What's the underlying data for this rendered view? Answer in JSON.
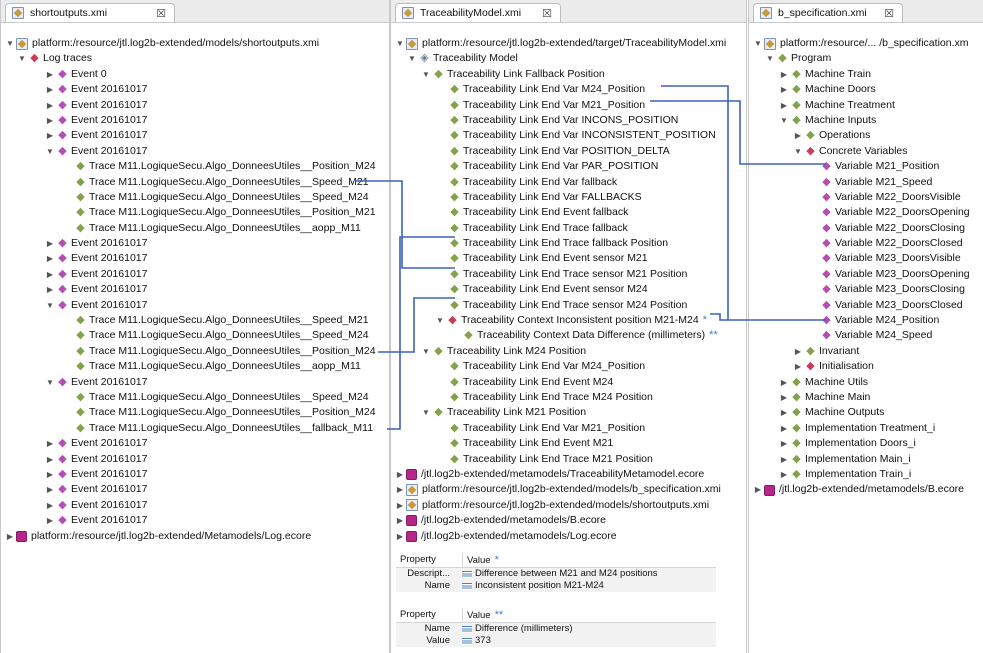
{
  "accent_color": "#3a63b8",
  "left": {
    "tab": "shortoutputs.xmi",
    "root": "platform:/resource/jtl.log2b-extended/models/shortoutputs.xmi",
    "log_traces": "Log traces",
    "event0": "Event 0",
    "event": "Event 20161017",
    "trace_speed_m21": "Trace M11.LogiqueSecu.Algo_DonneesUtiles__Speed_M21",
    "trace_speed_m24": "Trace M11.LogiqueSecu.Algo_DonneesUtiles__Speed_M24",
    "trace_pos_m21": "Trace M11.LogiqueSecu.Algo_DonneesUtiles__Position_M21",
    "trace_pos_m24": "Trace M11.LogiqueSecu.Algo_DonneesUtiles__Position_M24",
    "trace_aopp": "Trace M11.LogiqueSecu.Algo_DonneesUtiles__aopp_M11",
    "trace_fallback": "Trace M11.LogiqueSecu.Algo_DonneesUtiles__fallback_M11",
    "log_ecore": "platform:/resource/jtl.log2b-extended/Metamodels/Log.ecore"
  },
  "middle": {
    "tab": "TraceabilityModel.xmi",
    "root": "platform:/resource/jtl.log2b-extended/target/TraceabilityModel.xmi",
    "model": "Traceability Model",
    "fallback_position": "Traceability Link Fallback Position",
    "end_var_m24_pos": "Traceability Link End Var M24_Position",
    "end_var_m21_pos": "Traceability Link End Var M21_Position",
    "end_var_incons": "Traceability Link End Var INCONS_POSITION",
    "end_var_inconsistent": "Traceability Link End Var INCONSISTENT_POSITION",
    "end_var_delta": "Traceability Link End Var POSITION_DELTA",
    "end_var_par": "Traceability Link End Var PAR_POSITION",
    "end_var_fallback": "Traceability Link End Var fallback",
    "end_var_fallbacks": "Traceability Link End Var FALLBACKS",
    "end_event_fallback": "Traceability Link End Event fallback",
    "end_trace_fallback": "Traceability Link End Trace fallback",
    "end_trace_fallback_pos": "Traceability Link End Trace fallback Position",
    "end_event_sensor_m21": "Traceability Link End Event sensor M21",
    "end_trace_sensor_m21_pos": "Traceability Link End Trace sensor M21 Position",
    "end_event_sensor_m24": "Traceability Link End Event sensor M24",
    "end_trace_sensor_m24_pos": "Traceability Link End Trace sensor M24 Position",
    "context_incons": "Traceability Context Inconsistent position M21-M24",
    "context_data_diff": "Traceability Context Data Difference (millimeters)",
    "stars1": "*",
    "stars2": "**",
    "m24_position": "Traceability Link M24 Position",
    "end_var_m24_pos2": "Traceability Link End Var M24_Position",
    "end_event_m24": "Traceability Link End Event M24",
    "end_trace_m24_pos": "Traceability Link End Trace M24 Position",
    "m21_position": "Traceability Link M21 Position",
    "end_var_m21_pos2": "Traceability Link End Var M21_Position",
    "end_event_m21": "Traceability Link End Event M21",
    "end_trace_m21_pos": "Traceability Link End Trace M21 Position",
    "res_trace_metamodel": "/jtl.log2b-extended/metamodels/TraceabilityMetamodel.ecore",
    "res_b_spec": "platform:/resource/jtl.log2b-extended/models/b_specification.xmi",
    "res_shortoutputs": "platform:/resource/jtl.log2b-extended/models/shortoutputs.xmi",
    "res_b_ecore": "/jtl.log2b-extended/metamodels/B.ecore",
    "res_log_ecore": "/jtl.log2b-extended/metamodels/Log.ecore"
  },
  "props1": {
    "header_property": "Property",
    "header_value": "Value",
    "stars": "*",
    "rows": [
      {
        "key": "Descript...",
        "value": "Difference between M21 and M24 positions"
      },
      {
        "key": "Name",
        "value": "Inconsistent position M21-M24"
      }
    ]
  },
  "props2": {
    "header_property": "Property",
    "header_value": "Value",
    "stars": "**",
    "rows": [
      {
        "key": "Name",
        "value": "Difference (millimeters)"
      },
      {
        "key": "Value",
        "value": "373"
      }
    ]
  },
  "right": {
    "tab": "b_specification.xmi",
    "root": "platform:/resource/... /b_specification.xm",
    "program": "Program",
    "machine_train": "Machine Train",
    "machine_doors": "Machine Doors",
    "machine_treatment": "Machine Treatment",
    "machine_inputs": "Machine Inputs",
    "operations": "Operations",
    "concrete_variables": "Concrete Variables",
    "vars": [
      "Variable M21_Position",
      "Variable M21_Speed",
      "Variable M22_DoorsVisible",
      "Variable M22_DoorsOpening",
      "Variable M22_DoorsClosing",
      "Variable M22_DoorsClosed",
      "Variable M23_DoorsVisible",
      "Variable M23_DoorsOpening",
      "Variable M23_DoorsClosing",
      "Variable M23_DoorsClosed",
      "Variable M24_Position",
      "Variable M24_Speed"
    ],
    "invariant": "Invariant",
    "initialisation": "Initialisation",
    "machine_utils": "Machine Utils",
    "machine_main": "Machine Main",
    "machine_outputs": "Machine Outputs",
    "impl_treatment": "Implementation Treatment_i",
    "impl_doors": "Implementation Doors_i",
    "impl_main": "Implementation Main_i",
    "impl_train": "Implementation Train_i",
    "b_ecore": "/jtl.log2b-extended/metamodels/B.ecore"
  },
  "close_glyph": "☒"
}
